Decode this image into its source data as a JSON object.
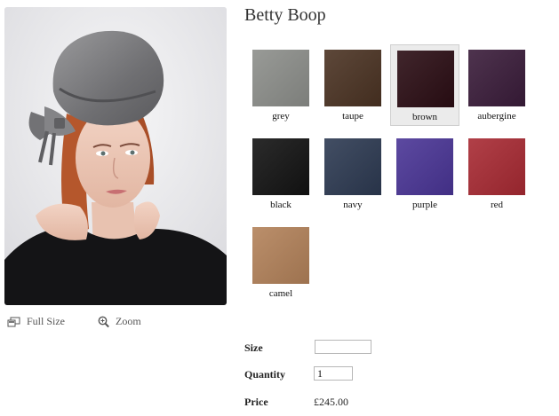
{
  "product": {
    "title": "Betty Boop"
  },
  "image_tools": {
    "full_size_label": "Full Size",
    "zoom_label": "Zoom"
  },
  "colours": [
    {
      "label": "grey",
      "swatch": "#8d8f8b",
      "selected": false
    },
    {
      "label": "taupe",
      "swatch": "#4b3323",
      "selected": false
    },
    {
      "label": "brown",
      "swatch": "#2b0d14",
      "selected": true
    },
    {
      "label": "aubergine",
      "swatch": "#3a1c3a",
      "selected": false
    },
    {
      "label": "black",
      "swatch": "#131313",
      "selected": false
    },
    {
      "label": "navy",
      "swatch": "#2d3a52",
      "selected": false
    },
    {
      "label": "purple",
      "swatch": "#4a3596",
      "selected": false
    },
    {
      "label": "red",
      "swatch": "#a82a33",
      "selected": false
    },
    {
      "label": "camel",
      "swatch": "#b3825a",
      "selected": false
    }
  ],
  "form": {
    "size_label": "Size",
    "size_value": "",
    "quantity_label": "Quantity",
    "quantity_value": "1",
    "price_label": "Price",
    "price_value": "£245.00"
  }
}
